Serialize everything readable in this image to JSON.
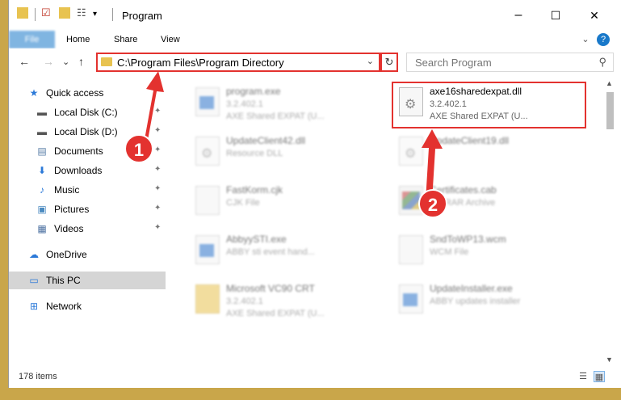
{
  "window": {
    "title": "Program",
    "controls": {
      "minimize": "–",
      "maximize": "☐",
      "close": "✕"
    }
  },
  "quick_access_toolbar": {
    "dropdown": "▾"
  },
  "ribbon": {
    "tabs": [
      {
        "label": "File"
      },
      {
        "label": "Home"
      },
      {
        "label": "Share"
      },
      {
        "label": "View"
      }
    ],
    "expand_icon": "⌄",
    "help_icon": "?"
  },
  "navigation": {
    "back": "←",
    "forward": "→",
    "recent": "⌄",
    "up": "↑",
    "address": "C:\\Program Files\\Program Directory",
    "address_dropdown": "⌄",
    "refresh": "↻",
    "search_placeholder": "Search Program",
    "search_icon": "🔍"
  },
  "sidebar": {
    "items": [
      {
        "label": "Quick access",
        "icon": "star-icon",
        "glyph": "★",
        "color": "#2b79d8",
        "pinned": false
      },
      {
        "label": "Local Disk (C:)",
        "icon": "drive-icon",
        "glyph": "▬",
        "color": "#555555",
        "pinned": true
      },
      {
        "label": "Local Disk (D:)",
        "icon": "drive-icon",
        "glyph": "▬",
        "color": "#555555",
        "pinned": true
      },
      {
        "label": "Documents",
        "icon": "documents-icon",
        "glyph": "▤",
        "color": "#5a7fa8",
        "pinned": true
      },
      {
        "label": "Downloads",
        "icon": "download-icon",
        "glyph": "⬇",
        "color": "#2b79d8",
        "pinned": true
      },
      {
        "label": "Music",
        "icon": "music-icon",
        "glyph": "♪",
        "color": "#2b79d8",
        "pinned": true
      },
      {
        "label": "Pictures",
        "icon": "pictures-icon",
        "glyph": "▣",
        "color": "#4a8ac0",
        "pinned": true
      },
      {
        "label": "Videos",
        "icon": "videos-icon",
        "glyph": "▦",
        "color": "#4a6fa0",
        "pinned": true
      },
      {
        "label": "OneDrive",
        "icon": "cloud-icon",
        "glyph": "☁",
        "color": "#2b79d8",
        "pinned": false
      },
      {
        "label": "This PC",
        "icon": "computer-icon",
        "glyph": "▭",
        "color": "#2b79d8",
        "pinned": false,
        "selected": true
      },
      {
        "label": "Network",
        "icon": "network-icon",
        "glyph": "⊞",
        "color": "#2b79d8",
        "pinned": false
      }
    ],
    "pin_glyph": "📌"
  },
  "files": [
    {
      "name": "program.exe",
      "line2": "3.2.402.1",
      "line3": "AXE Shared EXPAT (U...",
      "icon": "exe-icon"
    },
    {
      "name": "axe16sharedexpat.dll",
      "line2": "3.2.402.1",
      "line3": "AXE Shared EXPAT (U...",
      "icon": "dll-gear-icon",
      "highlighted": true
    },
    {
      "name": "UpdateClient42.dll",
      "line2": "Resource DLL",
      "line3": "",
      "icon": "dll-gear-icon"
    },
    {
      "name": "UpdateClient19.dll",
      "line2": "",
      "line3": "",
      "icon": "dll-gear-icon"
    },
    {
      "name": "FastKorm.cjk",
      "line2": "CJK File",
      "line3": "",
      "icon": "file-icon"
    },
    {
      "name": "Certificates.cab",
      "line2": "WinRAR Archive",
      "line3": "",
      "icon": "archive-icon"
    },
    {
      "name": "AbbyySTI.exe",
      "line2": "ABBY sti event hand...",
      "line3": "",
      "icon": "exe-icon"
    },
    {
      "name": "SndToWP13.wcm",
      "line2": "WCM File",
      "line3": "",
      "icon": "file-icon"
    },
    {
      "name": "Microsoft VC90 CRT",
      "line2": "3.2.402.1",
      "line3": "AXE Shared EXPAT (U...",
      "icon": "folder-icon"
    },
    {
      "name": "UpdateInstaller.exe",
      "line2": "ABBY updates installer",
      "line3": "",
      "icon": "exe-icon"
    }
  ],
  "annotations": {
    "badge1": "1",
    "badge2": "2",
    "color": "#e3322f"
  },
  "status": {
    "count": "178 items",
    "details_view_icon": "☰",
    "tiles_view_icon": "▦"
  },
  "scrollbar": {
    "up": "▲",
    "down": "▼"
  }
}
